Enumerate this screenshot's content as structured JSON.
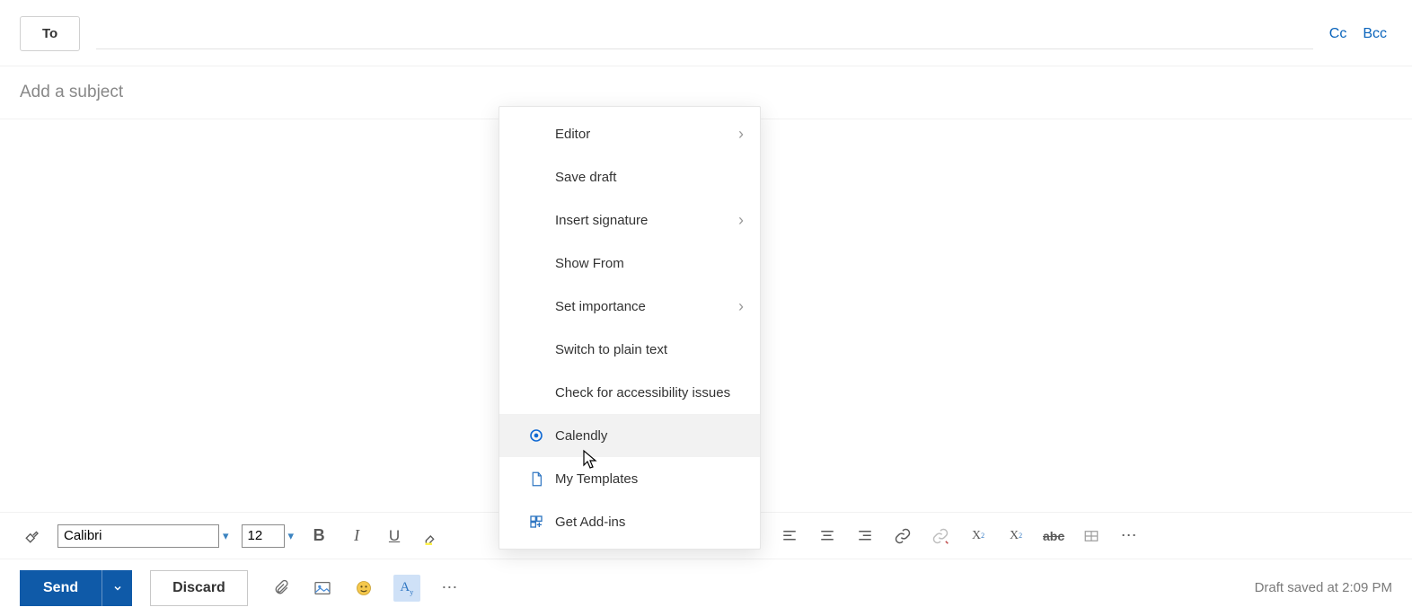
{
  "recipients": {
    "to_label": "To",
    "cc_label": "Cc",
    "bcc_label": "Bcc"
  },
  "subject": {
    "placeholder": "Add a subject"
  },
  "context_menu": {
    "items": [
      {
        "label": "Editor",
        "submenu": true,
        "icon": ""
      },
      {
        "label": "Save draft",
        "submenu": false,
        "icon": ""
      },
      {
        "label": "Insert signature",
        "submenu": true,
        "icon": ""
      },
      {
        "label": "Show From",
        "submenu": false,
        "icon": ""
      },
      {
        "label": "Set importance",
        "submenu": true,
        "icon": ""
      },
      {
        "label": "Switch to plain text",
        "submenu": false,
        "icon": ""
      },
      {
        "label": "Check for accessibility issues",
        "submenu": false,
        "icon": ""
      },
      {
        "label": "Calendly",
        "submenu": false,
        "icon": "calendly"
      },
      {
        "label": "My Templates",
        "submenu": false,
        "icon": "templates"
      },
      {
        "label": "Get Add-ins",
        "submenu": false,
        "icon": "addins"
      }
    ]
  },
  "format_toolbar": {
    "font_name": "Calibri",
    "font_size": "12"
  },
  "actions": {
    "send_label": "Send",
    "discard_label": "Discard"
  },
  "status": {
    "draft_saved": "Draft saved at 2:09 PM"
  }
}
